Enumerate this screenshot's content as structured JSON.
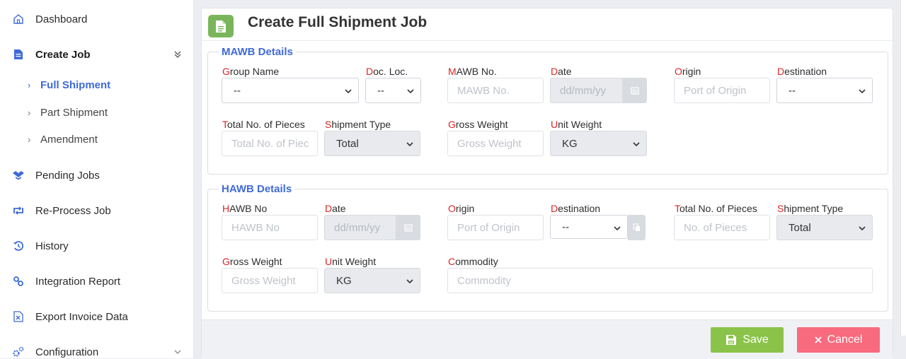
{
  "sidebar": {
    "items": [
      {
        "label": "Dashboard",
        "icon": "home-icon"
      },
      {
        "label": "Create Job",
        "icon": "document-icon"
      },
      {
        "label": "Pending Jobs",
        "icon": "dropbox-icon"
      },
      {
        "label": "Re-Process Job",
        "icon": "retweet-icon"
      },
      {
        "label": "History",
        "icon": "history-icon"
      },
      {
        "label": "Integration Report",
        "icon": "link-icon"
      },
      {
        "label": "Export Invoice Data",
        "icon": "excel-file-icon"
      },
      {
        "label": "Configuration",
        "icon": "gears-icon"
      }
    ],
    "sub_items": [
      {
        "label": "Full Shipment"
      },
      {
        "label": "Part Shipment"
      },
      {
        "label": "Amendment"
      }
    ]
  },
  "page": {
    "title": "Create Full Shipment Job"
  },
  "mawb": {
    "legend": "MAWB Details",
    "group_name": {
      "first": "G",
      "rest": "roup Name",
      "value": "--"
    },
    "doc_loc": {
      "first": "D",
      "rest": "oc. Loc.",
      "value": "--"
    },
    "mawb_no": {
      "first": "M",
      "rest": "AWB No.",
      "placeholder": "MAWB No."
    },
    "date": {
      "first": "D",
      "rest": "ate",
      "placeholder": "dd/mm/yy"
    },
    "origin": {
      "first": "O",
      "rest": "rigin",
      "placeholder": "Port of Origin"
    },
    "destination": {
      "first": "D",
      "rest": "estination",
      "value": "--"
    },
    "total_pieces": {
      "first": "T",
      "rest": "otal No. of Pieces",
      "placeholder": "Total No. of Piec"
    },
    "shipment_type": {
      "first": "S",
      "rest": "hipment Type",
      "value": "Total"
    },
    "gross_weight": {
      "first": "G",
      "rest": "ross Weight",
      "placeholder": "Gross Weight"
    },
    "unit_weight": {
      "first": "U",
      "rest": "nit Weight",
      "value": "KG"
    }
  },
  "hawb": {
    "legend": "HAWB Details",
    "hawb_no": {
      "first": "H",
      "rest": "AWB No",
      "placeholder": "HAWB No"
    },
    "date": {
      "first": "D",
      "rest": "ate",
      "placeholder": "dd/mm/yy"
    },
    "origin": {
      "first": "O",
      "rest": "rigin",
      "placeholder": "Port of Origin"
    },
    "destination": {
      "first": "D",
      "rest": "estination",
      "value": "--"
    },
    "total_pieces": {
      "first": "T",
      "rest": "otal No. of Pieces",
      "placeholder": "No. of Pieces"
    },
    "shipment_type": {
      "first": "S",
      "rest": "hipment Type",
      "value": "Total"
    },
    "gross_weight": {
      "first": "G",
      "rest": "ross Weight",
      "placeholder": "Gross Weight"
    },
    "unit_weight": {
      "first": "U",
      "rest": "nit Weight",
      "value": "KG"
    },
    "commodity": {
      "first": "C",
      "rest": "ommodity",
      "placeholder": "Commodity"
    }
  },
  "footer": {
    "save_label": "Save",
    "cancel_label": "Cancel"
  },
  "colors": {
    "accent": "#3f6ad8",
    "required": "#e02424",
    "save": "#8bc34a",
    "cancel": "#f86b7e"
  }
}
